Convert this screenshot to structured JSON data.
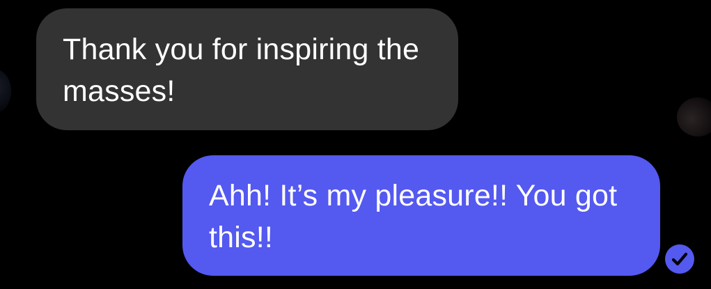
{
  "conversation": {
    "messages": [
      {
        "direction": "incoming",
        "text": "Thank you for inspiring the masses!"
      },
      {
        "direction": "outgoing",
        "text": "Ahh! It’s my pleasure!! You got this!!"
      }
    ],
    "read_receipt_icon": "check-circle-icon"
  },
  "colors": {
    "background": "#000000",
    "incoming_bubble": "#333333",
    "outgoing_bubble": "#5459f0",
    "text": "#ffffff"
  }
}
